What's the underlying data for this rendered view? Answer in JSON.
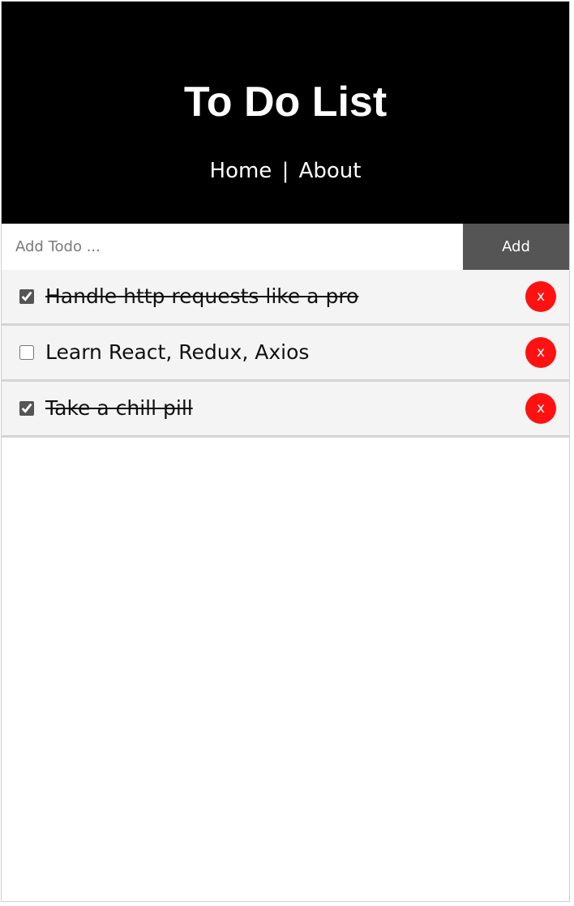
{
  "header": {
    "title": "To Do List",
    "nav": {
      "home": "Home",
      "separator": "|",
      "about": "About"
    }
  },
  "add_form": {
    "placeholder": "Add Todo ...",
    "value": "",
    "button_label": "Add"
  },
  "todos": [
    {
      "title": "Handle http requests like a pro",
      "completed": true,
      "delete_label": "x"
    },
    {
      "title": "Learn React, Redux, Axios",
      "completed": false,
      "delete_label": "x"
    },
    {
      "title": "Take a chill pill",
      "completed": true,
      "delete_label": "x"
    }
  ],
  "colors": {
    "header_bg": "#000000",
    "add_button_bg": "#555555",
    "item_bg": "#f4f4f4",
    "delete_button_bg": "#ff1111"
  }
}
